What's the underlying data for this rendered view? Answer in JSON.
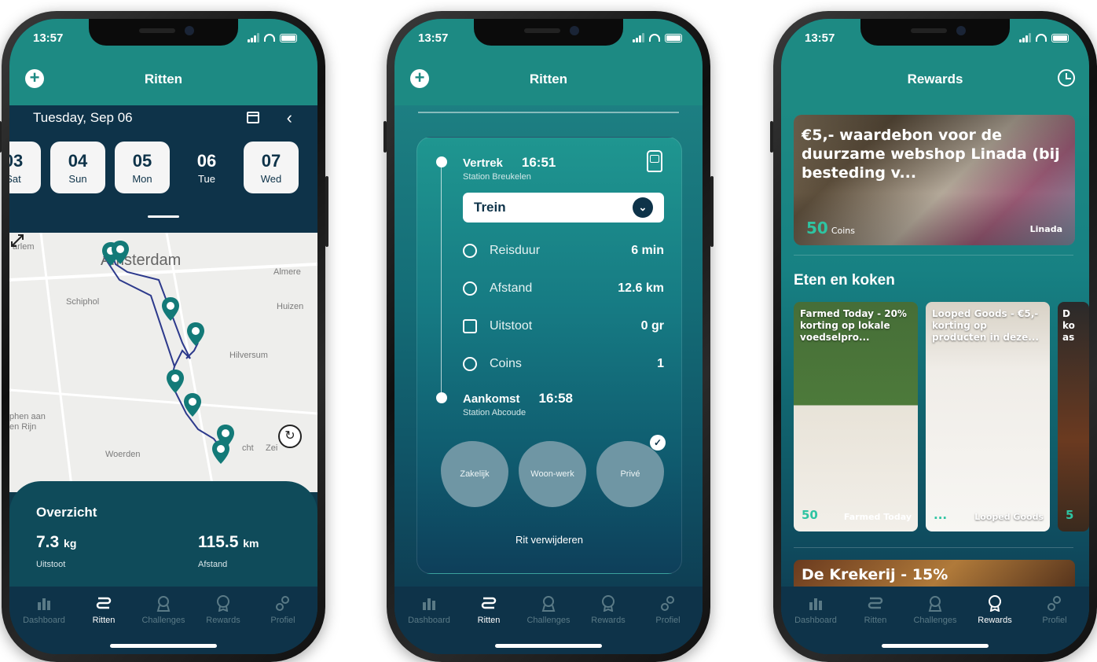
{
  "status": {
    "time": "13:57"
  },
  "tabs": [
    "Dashboard",
    "Ritten",
    "Challenges",
    "Rewards",
    "Profiel"
  ],
  "phone1": {
    "title": "Ritten",
    "date": "Tuesday, Sep 06",
    "days": [
      {
        "num": "03",
        "name": "Sat"
      },
      {
        "num": "04",
        "name": "Sun"
      },
      {
        "num": "05",
        "name": "Mon"
      },
      {
        "num": "06",
        "name": "Tue"
      },
      {
        "num": "07",
        "name": "Wed"
      }
    ],
    "map_labels": {
      "haarlem": "arlem",
      "amsterdam": "Amsterdam",
      "almere": "Almere",
      "schiphol": "Schiphol",
      "huizen": "Huizen",
      "hilversum": "Hilversum",
      "alphen": "phen aan\nen Rijn",
      "woerden": "Woerden",
      "utrecht": "cht",
      "zeist": "Zei"
    },
    "overview": {
      "title": "Overzicht",
      "emission_value": "7.3",
      "emission_unit": "kg",
      "emission_label": "Uitstoot",
      "distance_value": "115.5",
      "distance_unit": "km",
      "distance_label": "Afstand"
    }
  },
  "phone2": {
    "title": "Ritten",
    "departure": {
      "label": "Vertrek",
      "time": "16:51",
      "station": "Station Breukelen"
    },
    "mode": "Trein",
    "rows": [
      {
        "label": "Reisduur",
        "value": "6 min",
        "icon": "clock-icon"
      },
      {
        "label": "Afstand",
        "value": "12.6 km",
        "icon": "route-icon"
      },
      {
        "label": "Uitstoot",
        "value": "0 gr",
        "icon": "co2-icon"
      },
      {
        "label": "Coins",
        "value": "1",
        "icon": "coin-icon"
      }
    ],
    "arrival": {
      "label": "Aankomst",
      "time": "16:58",
      "station": "Station Abcoude"
    },
    "categories": [
      "Zakelijk",
      "Woon-werk",
      "Privé"
    ],
    "delete_label": "Rit verwijderen"
  },
  "phone3": {
    "title": "Rewards",
    "hero": {
      "title": "€5,- waardebon voor de duurzame webshop Linada (bij besteding v...",
      "coins": "50",
      "coins_label": "Coins",
      "brand": "Linada"
    },
    "section_title": "Eten en koken",
    "products": [
      {
        "title": "Farmed Today - 20% korting op lokale voedselpro...",
        "coins": "50",
        "brand": "Farmed Today"
      },
      {
        "title": "Looped Goods - €5,- korting op producten in deze...",
        "coins": "...",
        "brand": "Looped Goods"
      },
      {
        "title": "D\nko\nas",
        "coins": "5",
        "brand": ""
      }
    ],
    "next_card_title": "De Krekerij - 15%"
  },
  "colors": {
    "teal": "#1d8a83",
    "navy": "#0e3349",
    "mint": "#2ec4a2"
  }
}
